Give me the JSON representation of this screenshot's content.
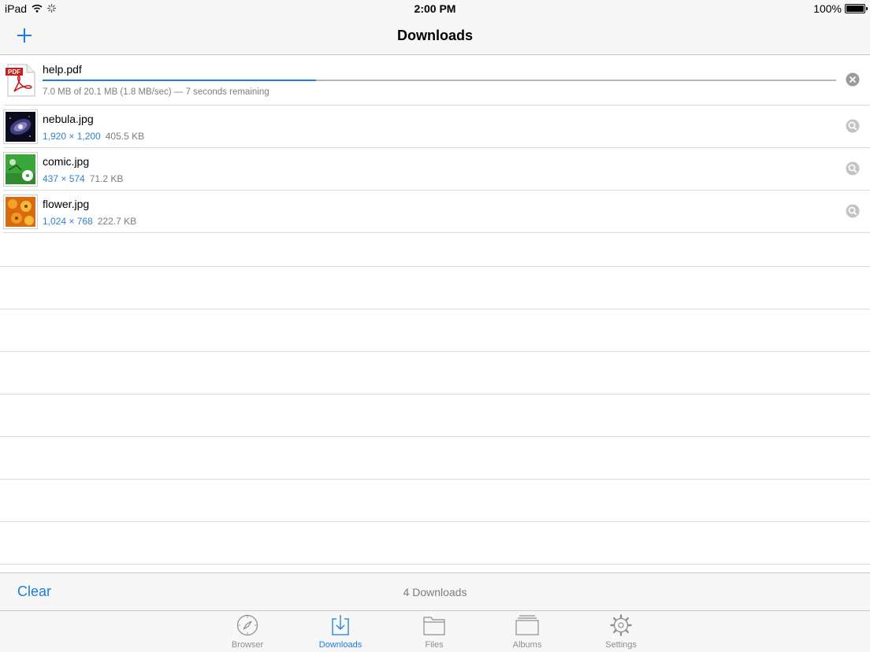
{
  "status_bar": {
    "device": "iPad",
    "time": "2:00 PM",
    "battery": "100%"
  },
  "nav": {
    "title": "Downloads",
    "add_icon": "plus-icon"
  },
  "downloads": [
    {
      "name": "help.pdf",
      "progress_text": "7.0 MB of 20.1 MB (1.8 MB/sec) — 7 seconds remaining",
      "progress": 0.345,
      "action_icon": "cancel-icon"
    },
    {
      "name": "nebula.jpg",
      "dimensions": "1,920 × 1,200",
      "size": "405.5 KB",
      "action_icon": "preview-icon"
    },
    {
      "name": "comic.jpg",
      "dimensions": "437 × 574",
      "size": "71.2 KB",
      "action_icon": "preview-icon"
    },
    {
      "name": "flower.jpg",
      "dimensions": "1,024 × 768",
      "size": "222.7 KB",
      "action_icon": "preview-icon"
    }
  ],
  "toolbar": {
    "clear_label": "Clear",
    "count_label": "4 Downloads"
  },
  "tabs": [
    {
      "label": "Browser",
      "icon": "compass-icon",
      "active": false
    },
    {
      "label": "Downloads",
      "icon": "download-icon",
      "active": true
    },
    {
      "label": "Files",
      "icon": "folder-icon",
      "active": false
    },
    {
      "label": "Albums",
      "icon": "albums-icon",
      "active": false
    },
    {
      "label": "Settings",
      "icon": "gear-icon",
      "active": false
    }
  ],
  "colors": {
    "accent": "#1a7ee0",
    "secondary_text": "#7d7d7d",
    "bar_background": "#f7f7f7"
  }
}
